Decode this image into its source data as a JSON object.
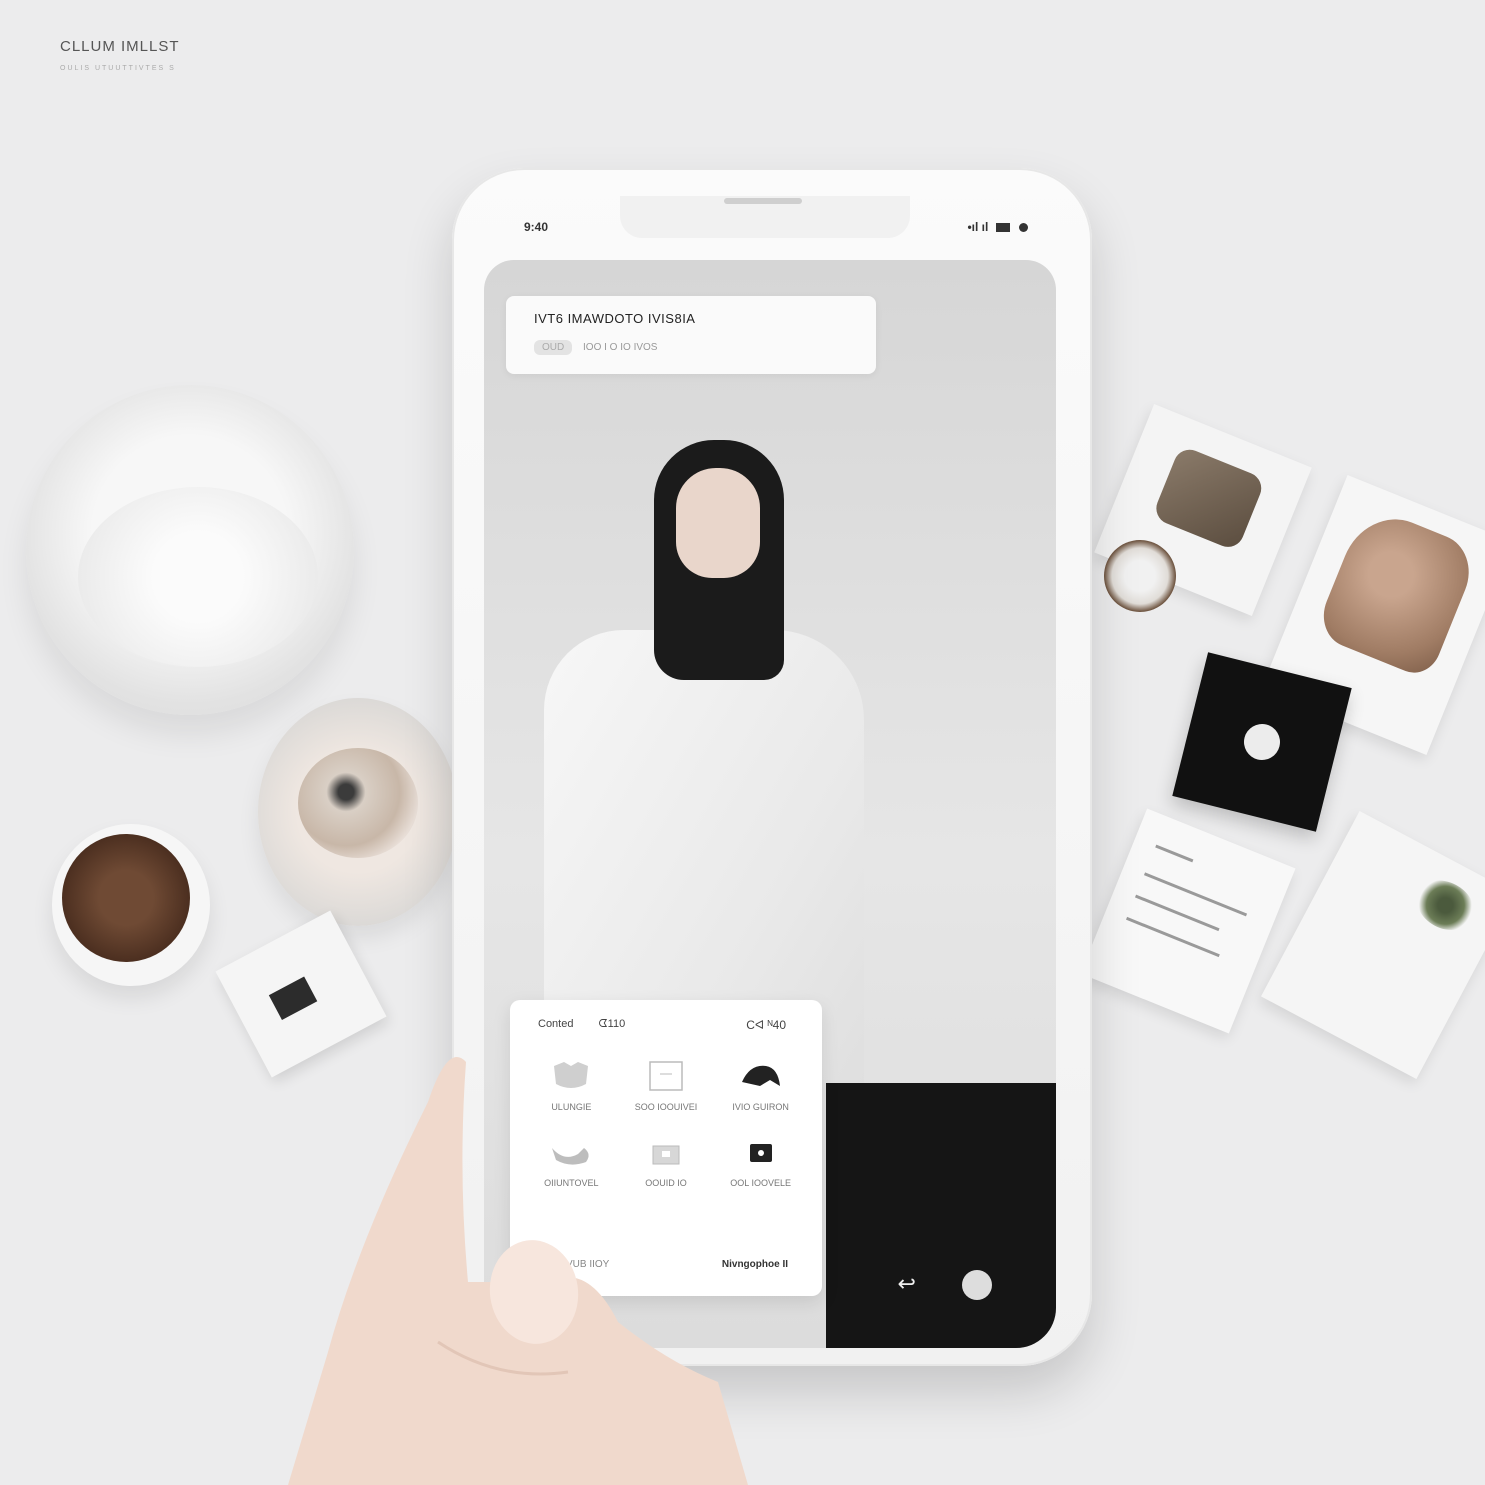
{
  "brand": {
    "name": "CLLUM IMLLST",
    "tagline": "OULIS UTUUTTIVTES S"
  },
  "status_bar": {
    "time": "9:40",
    "signal": "•ıl ıl"
  },
  "header_card": {
    "title": "IVT6 IMAWDOTO IVIS8IA",
    "pill": "OUD",
    "meta": "IOO I O   IO   IVOS"
  },
  "panel": {
    "top_left": [
      "Conted",
      "ᗧ110"
    ],
    "top_right": "Cᐊ ᴺ40",
    "items": [
      {
        "label": "ULUNGIE",
        "icon": "shirt-icon"
      },
      {
        "label": "SOO IOOUIVEI",
        "icon": "frame-icon"
      },
      {
        "label": "IVIO GUIRON",
        "icon": "hat-icon"
      },
      {
        "label": "OIIUNTOVEL",
        "icon": "shoe-icon"
      },
      {
        "label": "OOUID IO",
        "icon": "bag-icon"
      },
      {
        "label": "OOL IOOVELE",
        "icon": "camera-icon"
      }
    ],
    "footer_left": "VUB IIOY",
    "footer_right": "Nivngophoe  II"
  },
  "bottom_icons": {
    "back": "↩"
  },
  "colors": {
    "background": "#ececed",
    "phone": "#f7f7f7",
    "accent_dark": "#151515"
  }
}
